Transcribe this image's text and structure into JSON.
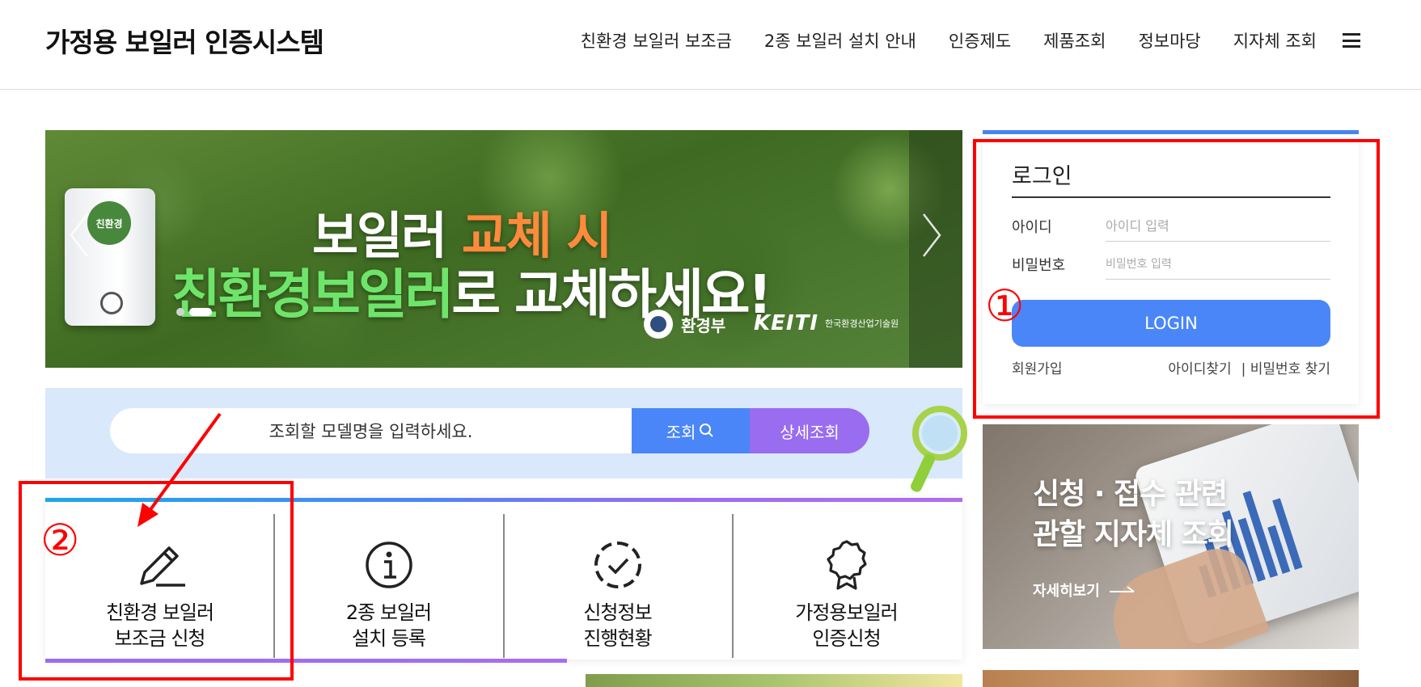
{
  "header": {
    "site_title": "가정용 보일러 인증시스템",
    "nav": [
      "친환경 보일러 보조금",
      "2종 보일러 설치 안내",
      "인증제도",
      "제품조회",
      "정보마당",
      "지자체 조회"
    ]
  },
  "banner": {
    "line1_prefix": "보일러 ",
    "line1_highlight": "교체 시",
    "line2_highlight": "친환경보일러",
    "line2_suffix": "로 교체하세요!",
    "boiler_badge": "친환경",
    "org1": "환경부",
    "org2_logo": "KEITI",
    "org2_name": "한국환경산업기술원",
    "slide_index": 2
  },
  "search": {
    "placeholder": "조회할 모델명을 입력하세요.",
    "search_label": "조회",
    "detail_label": "상세조회"
  },
  "quick_menu": [
    {
      "line1": "친환경 보일러",
      "line2": "보조금 신청",
      "icon": "pencil-icon"
    },
    {
      "line1": "2종 보일러",
      "line2": "설치 등록",
      "icon": "info-icon"
    },
    {
      "line1": "신청정보",
      "line2": "진행현황",
      "icon": "check-circle-icon"
    },
    {
      "line1": "가정용보일러",
      "line2": "인증신청",
      "icon": "award-icon"
    }
  ],
  "login": {
    "title": "로그인",
    "id_label": "아이디",
    "id_placeholder": "아이디 입력",
    "pw_label": "비밀번호",
    "pw_placeholder": "비밀번호 입력",
    "button": "LOGIN",
    "signup": "회원가입",
    "find_id": "아이디찾기",
    "find_pw": "| 비밀번호 찾기"
  },
  "info_card": {
    "title_line1": "신청 · 접수 관련",
    "title_line2": "관할 지자체 조회",
    "link": "자세히보기"
  },
  "annotations": {
    "marker1": "①",
    "marker2": "②",
    "color": "#ff0000"
  },
  "colors": {
    "primary": "#4a86f7",
    "purple": "#9a6cf0",
    "search_bg": "#d9e8fb"
  }
}
